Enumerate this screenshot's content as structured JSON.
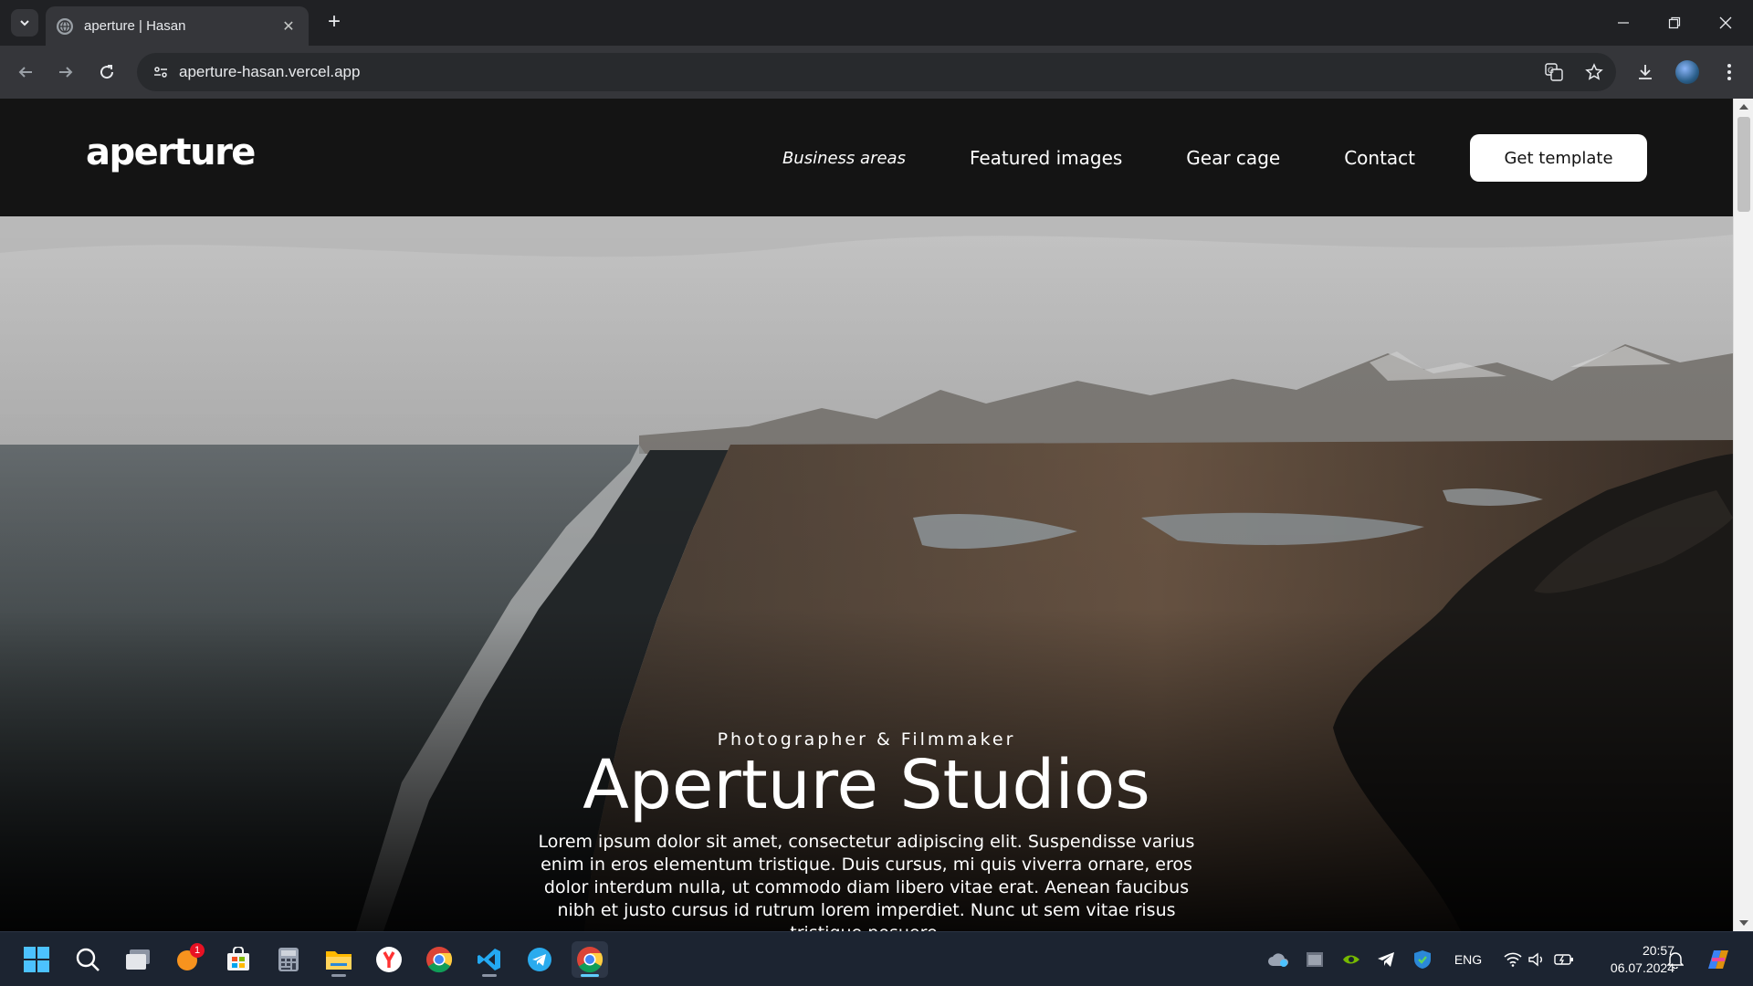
{
  "browser": {
    "tab_title": "aperture | Hasan",
    "url": "aperture-hasan.vercel.app"
  },
  "site": {
    "logo": "aperture",
    "nav": {
      "item1": "Business areas",
      "item2": "Featured images",
      "item3": "Gear cage",
      "item4": "Contact",
      "cta": "Get template"
    },
    "hero": {
      "eyebrow": "Photographer & Filmmaker",
      "title": "Aperture Studios",
      "body": "Lorem ipsum dolor sit amet, consectetur adipiscing elit. Suspendisse varius enim in eros elementum tristique. Duis cursus, mi quis viverra ornare, eros dolor interdum nulla, ut commodo diam libero vitae erat. Aenean faucibus nibh et justo cursus id rutrum lorem imperdiet. Nunc ut sem vitae risus tristique posuere."
    }
  },
  "taskbar": {
    "notification_badge": "1",
    "language": "ENG",
    "time": "20:57",
    "date": "06.07.2024"
  },
  "colors": {
    "chrome_dark": "#202124",
    "toolbar": "#35363a",
    "header_bg": "#141414",
    "taskbar_bg": "#1c2431",
    "accent_blue": "#60cdff"
  }
}
